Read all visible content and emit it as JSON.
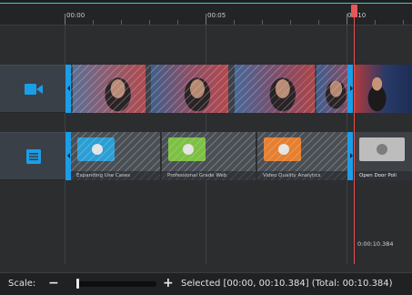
{
  "timeline": {
    "ruler_labels": [
      "00:00",
      "00:05",
      "00:10"
    ],
    "playhead_time": "0:00:10.384"
  },
  "tracks": {
    "video": {
      "icon": "video-camera-icon"
    },
    "title": {
      "icon": "list-lines-icon",
      "clips": [
        {
          "title": "Expanding Use Cases",
          "color": "#2a9fd6"
        },
        {
          "title": "Professional Grade Web",
          "color": "#7cc242"
        },
        {
          "title": "Video Quality Analytics",
          "color": "#e87f2e"
        },
        {
          "title": "Open Door Poli",
          "color": "#bdbdbd"
        }
      ]
    }
  },
  "status_bar": {
    "scale_label": "Scale:",
    "minus": "−",
    "plus": "+",
    "selected_text": "Selected [00:00, 00:10.384] (Total: 00:10.384)"
  },
  "colors": {
    "accent_blue": "#1a9ee8",
    "playhead_red": "#e25050",
    "teal": "#54c3c0"
  }
}
